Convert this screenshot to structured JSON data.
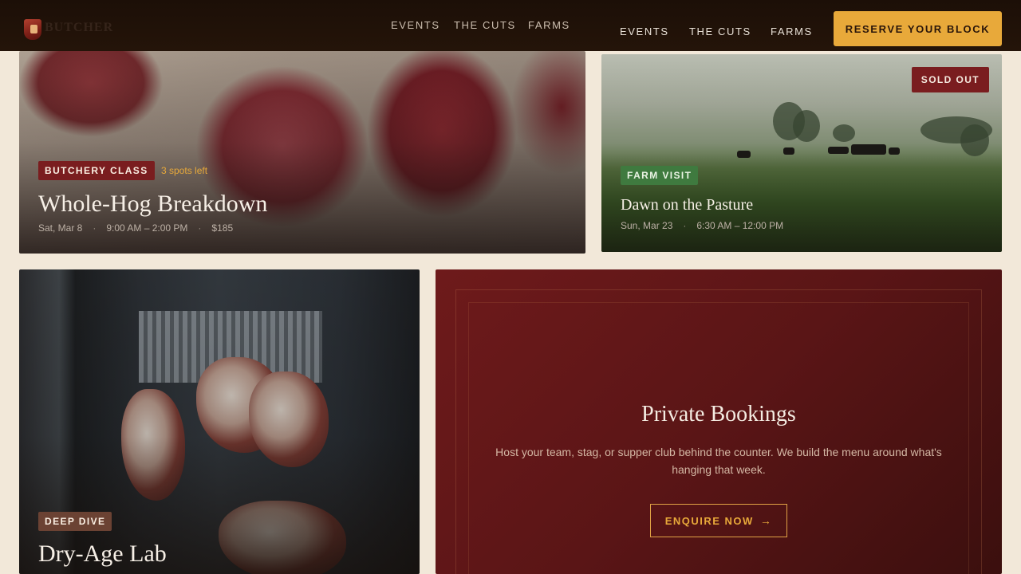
{
  "brand": {
    "wordmark": "BUTCHER",
    "logo_icon": "shield-logo-icon"
  },
  "nav_ghost": [
    "EVENTS",
    "THE CUTS",
    "FARMS"
  ],
  "nav": [
    "EVENTS",
    "THE CUTS",
    "FARMS"
  ],
  "cta": {
    "label": "RESERVE YOUR BLOCK",
    "color": "#e8a93a"
  },
  "events": [
    {
      "tag": "BUTCHERY CLASS",
      "spots": "3 spots left",
      "title": "Whole-Hog Breakdown",
      "date": "Sat, Mar 8",
      "time": "9:00 AM – 2:00 PM",
      "price": "$185",
      "image": "raw-meat-photo"
    },
    {
      "tag": "FARM VISIT",
      "badge": "SOLD OUT",
      "title": "Dawn on the Pasture",
      "date": "Sun, Mar 23",
      "time": "6:30 AM – 12:00 PM",
      "image": "cattle-pasture-photo"
    },
    {
      "tag": "DEEP DIVE",
      "title": "Dry-Age Lab",
      "image": "dry-age-locker-photo"
    }
  ],
  "private": {
    "title": "Private Bookings",
    "body": "Host your team, stag, or supper club behind the counter. We build the menu around what's hanging that week.",
    "button": "ENQUIRE NOW",
    "button_icon": "arrow-right-icon"
  },
  "colors": {
    "background": "#f2e8d9",
    "header": "#1c0f07",
    "burgundy": "#6e1a1b",
    "gold": "#e8a93a"
  },
  "separator": "·"
}
